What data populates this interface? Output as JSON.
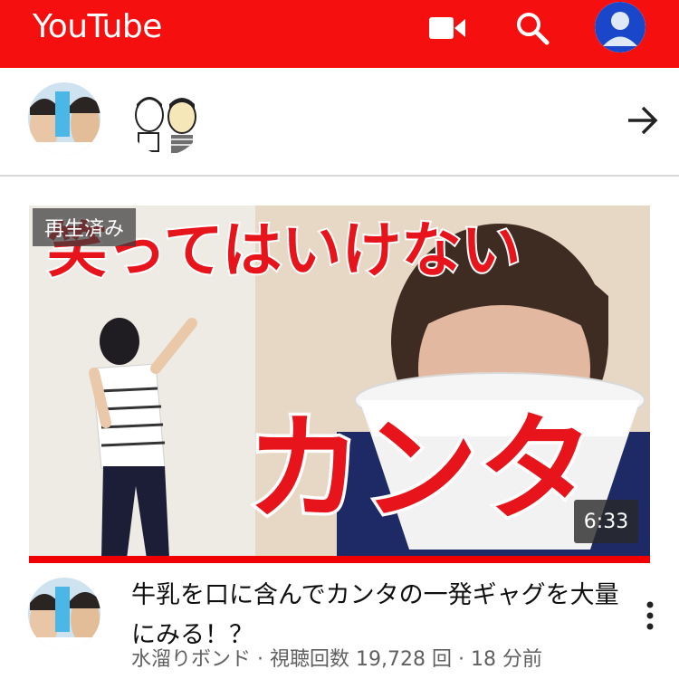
{
  "app": {
    "brand": "YouTube",
    "colors": {
      "header": "#f50f0f",
      "progress": "#f00000"
    }
  },
  "header": {
    "icons": [
      "video-camera-icon",
      "search-icon",
      "account-icon"
    ]
  },
  "subscriptions": {
    "channels": [
      {
        "avatar_text": "水溜りボンド"
      },
      {
        "avatar": "illustrated-duo"
      }
    ],
    "more_icon": "arrow-right-icon"
  },
  "video": {
    "thumbnail_overlay_top": "笑ってはいけない",
    "thumbnail_overlay_main": "カンタ",
    "watched_label": "再生済み",
    "duration": "6:33",
    "progress_fraction": 1.0,
    "title": "牛乳を口に含んでカンタの一発ギャグを大量にみる！？",
    "channel": "水溜りボンド",
    "views": "視聴回数 19,728 回",
    "age": "18 分前",
    "separator": " · "
  }
}
